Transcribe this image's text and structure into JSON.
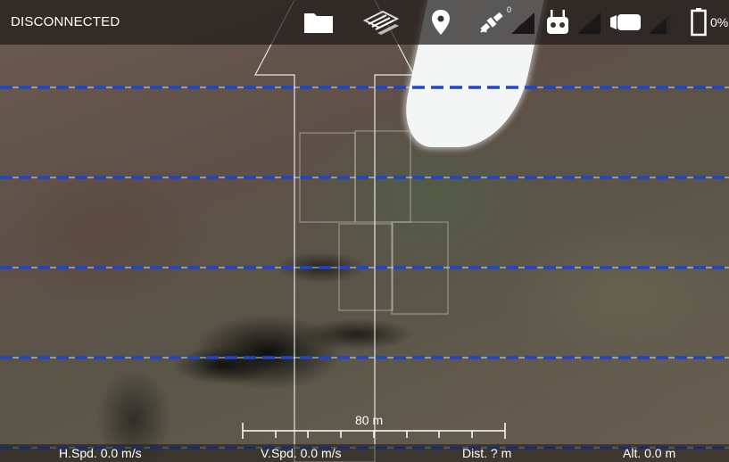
{
  "status": {
    "connection": "DISCONNECTED"
  },
  "toolbar": {
    "icons": [
      "folder-icon",
      "survey-grid-icon",
      "location-pin-icon",
      "satellite-icon",
      "remote-controller-icon",
      "camera-icon",
      "battery-icon"
    ],
    "satellite_count": "0",
    "battery_percent": "0%"
  },
  "map": {
    "scale_label": "80 m"
  },
  "telemetry": {
    "horizontal_speed": "H.Spd. 0.0 m/s",
    "vertical_speed": "V.Spd. 0.0 m/s",
    "distance": "Dist. ? m",
    "altitude": "Alt. 0.0 m"
  },
  "colors": {
    "flight_line": "#1f46c8",
    "overlay_white": "#ffffff",
    "bar_background": "#1e1a18"
  }
}
